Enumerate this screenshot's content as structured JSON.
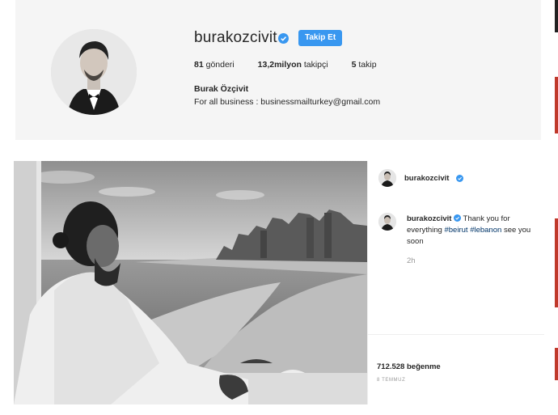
{
  "profile": {
    "username": "burakozcivit",
    "follow_label": "Takip Et",
    "posts": "81",
    "posts_label": "gönderi",
    "followers": "13,2milyon",
    "followers_label": "takipçi",
    "following": "5",
    "following_label": "takip",
    "full_name": "Burak Özçivit",
    "bio": "For all business : businessmailturkey@gmail.com"
  },
  "post": {
    "header_username": "burakozcivit",
    "caption_username": "burakozcivit",
    "caption_text": "Thank you for everything",
    "hashtag1": "#beirut",
    "hashtag2": "#lebanon",
    "caption_end": "see you soon",
    "time_ago": "2h",
    "likes": "712.528 beğenme",
    "date": "8 TEMMUZ"
  },
  "colors": {
    "accent": "#3897f0",
    "hashtag": "#003569",
    "card_bg": "#f5f5f5",
    "verified": "#3897f0"
  },
  "icons": [
    "verified-badge-icon"
  ]
}
